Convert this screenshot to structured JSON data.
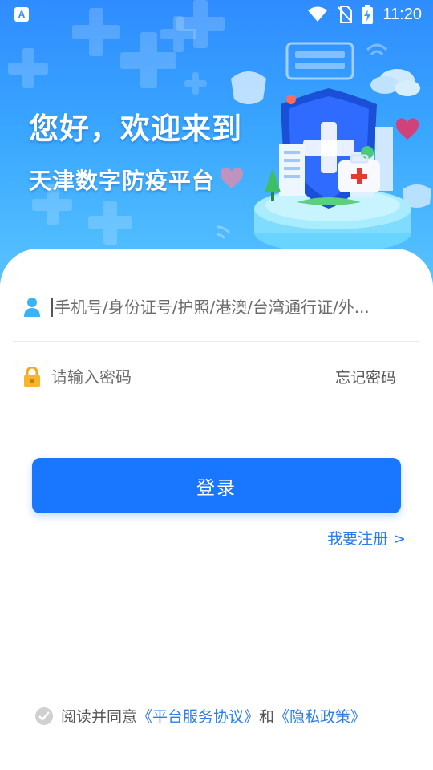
{
  "status_bar": {
    "app_badge": "A",
    "time": "11:20"
  },
  "hero": {
    "title": "您好，欢迎来到",
    "subtitle": "天津数字防疫平台"
  },
  "form": {
    "account_placeholder": "手机号/身份证号/护照/港澳/台湾通行证/外...",
    "password_placeholder": "请输入密码",
    "forgot_password": "忘记密码",
    "login_button": "登录",
    "register_link": "我要注册 >"
  },
  "agreement": {
    "prefix": "阅读并同意",
    "service_link": "《平台服务协议》",
    "joiner": "和",
    "privacy_link": "《隐私政策》"
  },
  "colors": {
    "primary": "#1976ff",
    "link": "#2b7de9",
    "hero_top": "#2f8cff",
    "hero_bottom": "#58c4ff"
  }
}
